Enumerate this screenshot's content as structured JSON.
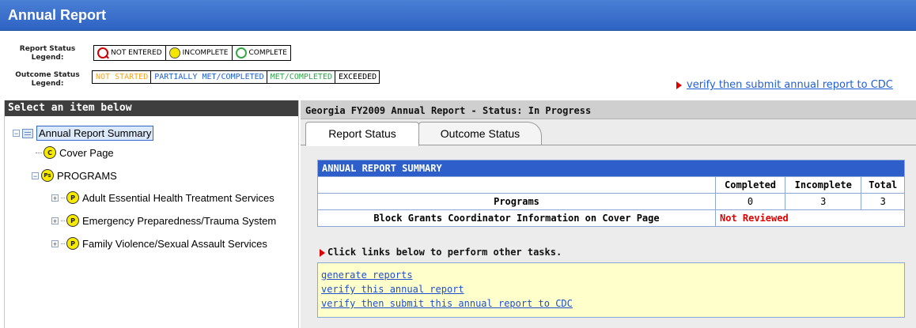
{
  "app_title": "Annual Report",
  "legend": {
    "report_status_label": "Report Status\nLegend:",
    "report_items": [
      {
        "label": "NOT ENTERED",
        "icon": "not-entered-icon"
      },
      {
        "label": "INCOMPLETE",
        "icon": "incomplete-icon"
      },
      {
        "label": "COMPLETE",
        "icon": "complete-icon"
      }
    ],
    "outcome_status_label": "Outcome Status\nLegend:",
    "outcome_items": [
      {
        "label": "NOT STARTED",
        "color": "#f5a623"
      },
      {
        "label": "PARTIALLY MET/COMPLETED",
        "color": "#2060d0"
      },
      {
        "label": "MET/COMPLETED",
        "color": "#2aa84a"
      },
      {
        "label": "EXCEEDED",
        "color": "#000000"
      }
    ]
  },
  "top_link": "verify then submit annual report to CDC",
  "left_panel": {
    "header": "Select an item below",
    "tree": {
      "root": "Annual Report Summary",
      "cover_page": "Cover Page",
      "programs": "PROGRAMS",
      "program_items": [
        "Adult Essential Health Treatment Services",
        "Emergency Preparedness/Trauma System",
        "Family Violence/Sexual Assault Services"
      ],
      "icon_letters": {
        "cover": "C",
        "programs": "Ps",
        "program": "P"
      }
    }
  },
  "right_panel": {
    "header": "Georgia FY2009 Annual Report - Status: In Progress",
    "tabs": [
      "Report Status",
      "Outcome Status"
    ],
    "summary": {
      "title": "ANNUAL REPORT SUMMARY",
      "columns": [
        "Completed",
        "Incomplete",
        "Total"
      ],
      "rows": [
        {
          "label": "Programs",
          "completed": "0",
          "incomplete": "3",
          "total": "3"
        },
        {
          "label": "Block Grants Coordinator Information on Cover Page",
          "status": "Not Reviewed"
        }
      ]
    },
    "tasks_label": "Click links below to perform other tasks.",
    "task_links": [
      "generate reports",
      "verify this annual report",
      "verify then submit this annual report to CDC"
    ]
  }
}
